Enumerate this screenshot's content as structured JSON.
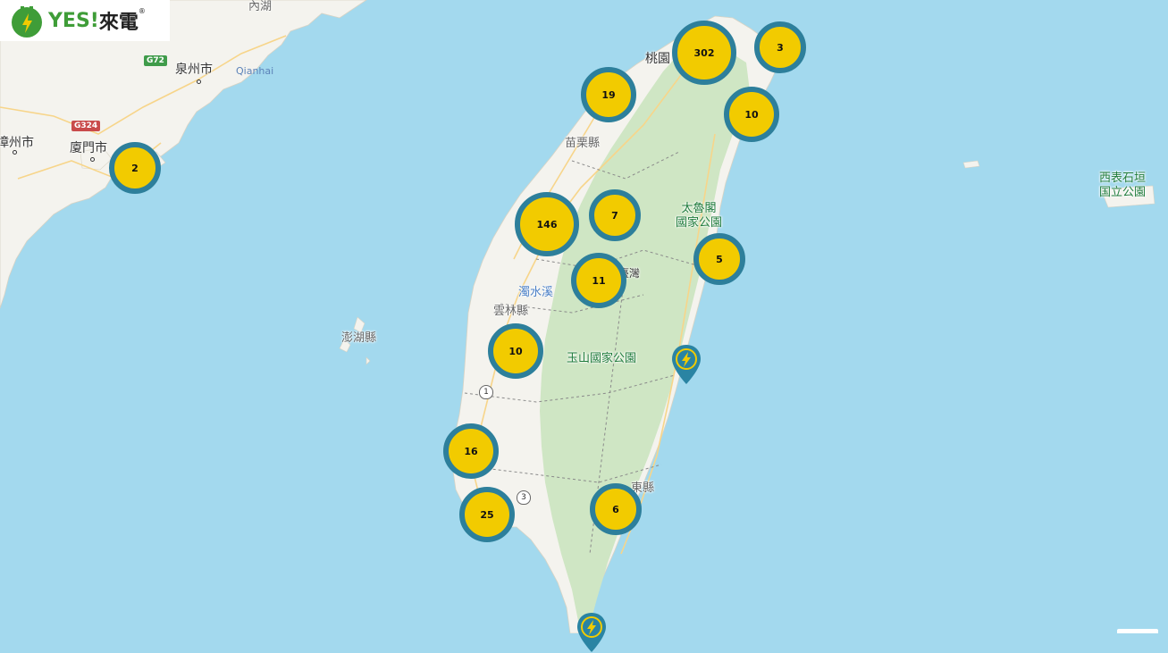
{
  "brand": {
    "latin": "YES!",
    "chinese": "來電",
    "reg_mark": "®"
  },
  "labels": {
    "quanzhou": "泉州市",
    "qianhai": "Qianhai",
    "xiamen": "廈門市",
    "zhangzhou": "漳州市",
    "neihu": "內湖",
    "taoyuan": "桃園",
    "miaoli": "苗栗縣",
    "taroko": "太魯閣\n國家公園",
    "taroko_line1": "太魯閣",
    "taroko_line2": "國家公園",
    "taiwan": "臺灣",
    "zhuoshui": "濁水溪",
    "yunlin": "雲林縣",
    "penghu": "澎湖縣",
    "yushan": "玉山國家公園",
    "xiyu_line1": "西表石垣",
    "xiyu_line2": "国立公園",
    "taitung_fragment": "東縣"
  },
  "highway_shields": {
    "g72": "G72",
    "g324": "G324"
  },
  "route_markers": [
    "1",
    "3"
  ],
  "clusters": [
    {
      "id": "kinmen",
      "count": "2"
    },
    {
      "id": "taoyuan",
      "count": "302"
    },
    {
      "id": "keelung",
      "count": "3"
    },
    {
      "id": "hsinchu",
      "count": "19"
    },
    {
      "id": "yilan",
      "count": "10"
    },
    {
      "id": "taichung",
      "count": "146"
    },
    {
      "id": "miaoli-east",
      "count": "7"
    },
    {
      "id": "hualien",
      "count": "5"
    },
    {
      "id": "nantou",
      "count": "11"
    },
    {
      "id": "chiayi",
      "count": "10"
    },
    {
      "id": "tainan",
      "count": "16"
    },
    {
      "id": "kaohsiung",
      "count": "25"
    },
    {
      "id": "taitung",
      "count": "6"
    }
  ],
  "single_markers": [
    "charging-station",
    "charging-station"
  ],
  "colors": {
    "sea": "#a3d9ee",
    "land_plain": "#f4f3ee",
    "land_mountain": "#cfe6c4",
    "cluster_fill": "#f2cb00",
    "cluster_ring": "#2d7f9b",
    "brand_green": "#3f9d38",
    "pin": "#2a84a3",
    "road": "#f7d58a"
  }
}
